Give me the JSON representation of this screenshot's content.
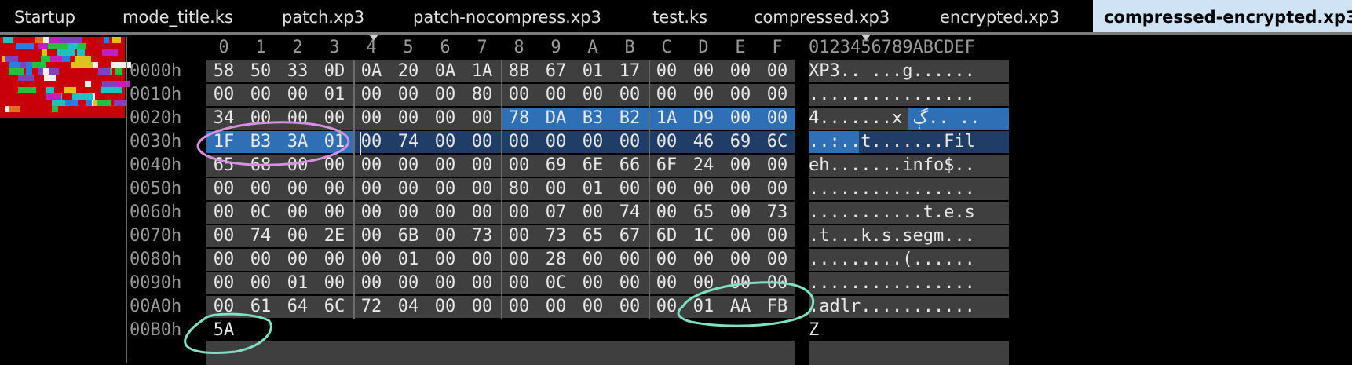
{
  "tabs": [
    {
      "label": "Startup"
    },
    {
      "label": "mode_title.ks"
    },
    {
      "label": "patch.xp3"
    },
    {
      "label": "patch-nocompress.xp3"
    },
    {
      "label": "test.ks"
    },
    {
      "label": "compressed.xp3"
    },
    {
      "label": "encrypted.xp3"
    },
    {
      "label": "compressed-encrypted.xp3"
    }
  ],
  "hex_view": {
    "column_headers": [
      "0",
      "1",
      "2",
      "3",
      "4",
      "5",
      "6",
      "7",
      "8",
      "9",
      "A",
      "B",
      "C",
      "D",
      "E",
      "F"
    ],
    "ascii_header": "0123456789ABCDEF",
    "rows": [
      {
        "offset": "0000h",
        "bytes": [
          "58",
          "50",
          "33",
          "0D",
          "0A",
          "20",
          "0A",
          "1A",
          "8B",
          "67",
          "01",
          "17",
          "00",
          "00",
          "00",
          "00"
        ],
        "ascii": "XP3.. ...g......"
      },
      {
        "offset": "0010h",
        "bytes": [
          "00",
          "00",
          "00",
          "01",
          "00",
          "00",
          "00",
          "80",
          "00",
          "00",
          "00",
          "00",
          "00",
          "00",
          "00",
          "00"
        ],
        "ascii": "................"
      },
      {
        "offset": "0020h",
        "bytes": [
          "34",
          "00",
          "00",
          "00",
          "00",
          "00",
          "00",
          "00",
          "78",
          "DA",
          "B3",
          "B2",
          "1A",
          "D9",
          "00",
          "00"
        ],
        "ascii": "4.......x ڳ.. .."
      },
      {
        "offset": "0030h",
        "bytes": [
          "1F",
          "B3",
          "3A",
          "01",
          "00",
          "74",
          "00",
          "00",
          "00",
          "00",
          "00",
          "00",
          "00",
          "46",
          "69",
          "6C"
        ],
        "ascii": "..:..t.......Fil"
      },
      {
        "offset": "0040h",
        "bytes": [
          "65",
          "68",
          "00",
          "00",
          "00",
          "00",
          "00",
          "00",
          "00",
          "69",
          "6E",
          "66",
          "6F",
          "24",
          "00",
          "00"
        ],
        "ascii": "eh.......info$.."
      },
      {
        "offset": "0050h",
        "bytes": [
          "00",
          "00",
          "00",
          "00",
          "00",
          "00",
          "00",
          "00",
          "80",
          "00",
          "01",
          "00",
          "00",
          "00",
          "00",
          "00"
        ],
        "ascii": "................"
      },
      {
        "offset": "0060h",
        "bytes": [
          "00",
          "0C",
          "00",
          "00",
          "00",
          "00",
          "00",
          "00",
          "00",
          "07",
          "00",
          "74",
          "00",
          "65",
          "00",
          "73"
        ],
        "ascii": "...........t.e.s"
      },
      {
        "offset": "0070h",
        "bytes": [
          "00",
          "74",
          "00",
          "2E",
          "00",
          "6B",
          "00",
          "73",
          "00",
          "73",
          "65",
          "67",
          "6D",
          "1C",
          "00",
          "00"
        ],
        "ascii": ".t...k.s.segm..."
      },
      {
        "offset": "0080h",
        "bytes": [
          "00",
          "00",
          "00",
          "00",
          "00",
          "01",
          "00",
          "00",
          "00",
          "28",
          "00",
          "00",
          "00",
          "00",
          "00",
          "00"
        ],
        "ascii": ".........(......"
      },
      {
        "offset": "0090h",
        "bytes": [
          "00",
          "00",
          "01",
          "00",
          "00",
          "00",
          "00",
          "00",
          "00",
          "0C",
          "00",
          "00",
          "00",
          "00",
          "00",
          "00"
        ],
        "ascii": "................"
      },
      {
        "offset": "00A0h",
        "bytes": [
          "00",
          "61",
          "64",
          "6C",
          "72",
          "04",
          "00",
          "00",
          "00",
          "00",
          "00",
          "00",
          "00",
          "01",
          "AA",
          "FB"
        ],
        "ascii": ".adlr..........."
      },
      {
        "offset": "00B0h",
        "bytes": [
          "5A"
        ],
        "ascii": "Z"
      }
    ]
  }
}
